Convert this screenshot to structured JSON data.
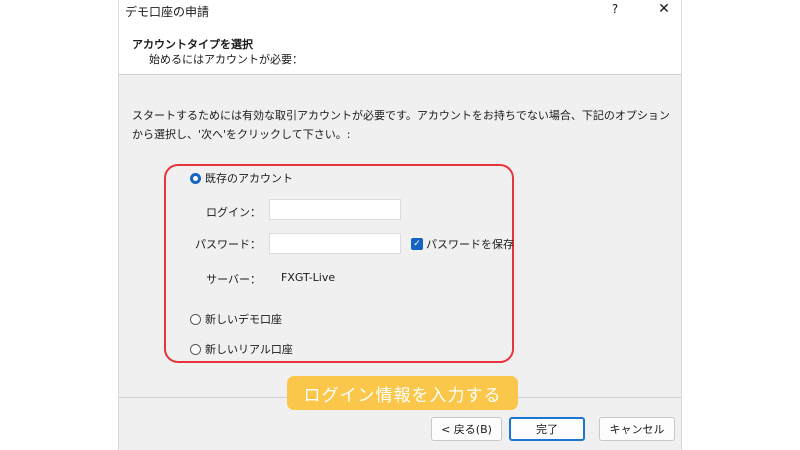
{
  "window": {
    "title": "デモ口座の申請",
    "help_label": "?",
    "close_label": "✕"
  },
  "header": {
    "title": "アカウントタイプを選択",
    "subtitle": "始めるにはアカウントが必要："
  },
  "description": "スタートするためには有効な取引アカウントが必要です。アカウントをお持ちでない場合、下記のオプションから選択し、'次へ'をクリックして下さい。:",
  "options": {
    "existing": {
      "label": "既存のアカウント",
      "checked": true
    },
    "new_demo": {
      "label": "新しいデモ口座",
      "checked": false
    },
    "new_real": {
      "label": "新しいリアル口座",
      "checked": false
    }
  },
  "form": {
    "login_label": "ログイン：",
    "login_value": "",
    "password_label": "パスワード：",
    "password_value": "",
    "save_password_label": "パスワードを保存",
    "save_password_checked": true,
    "server_label": "サーバー：",
    "server_value": "FXGT-Live"
  },
  "annotation": {
    "callout_text": "ログイン情報を入力する",
    "highlight_color": "#e8323c",
    "callout_color": "#fbc74a"
  },
  "buttons": {
    "back_label": "< 戻る(B)",
    "finish_label": "完了",
    "cancel_label": "キャンセル"
  },
  "colors": {
    "accent": "#1565c0",
    "dialog_bg": "#f0f0f0"
  }
}
